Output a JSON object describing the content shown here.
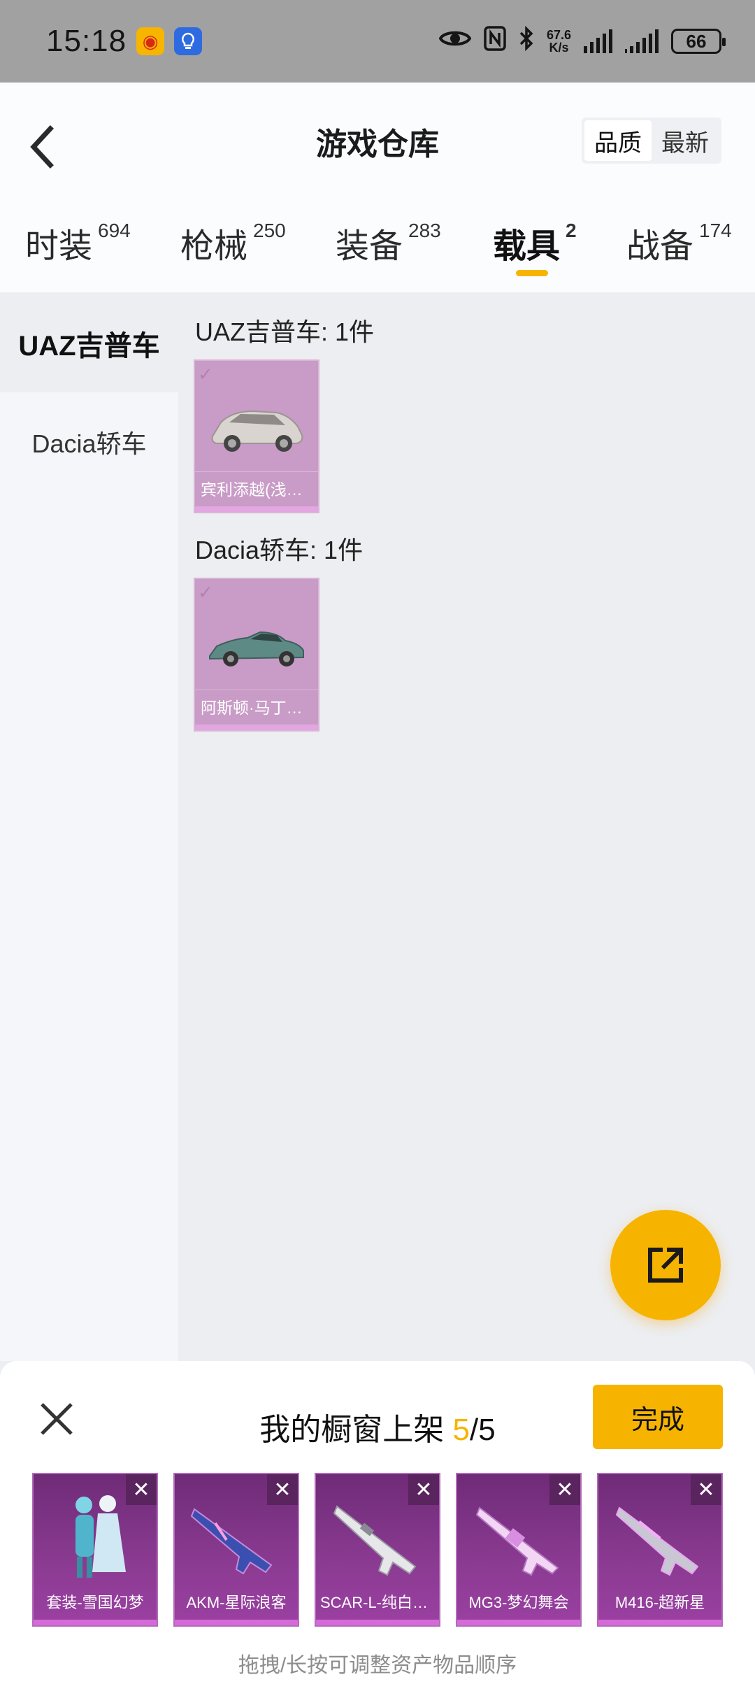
{
  "status_bar": {
    "time": "15:18",
    "net_speed_value": "67.6",
    "net_speed_unit": "K/s",
    "battery": "66",
    "icons": [
      "weibo-icon",
      "bulb-icon",
      "eye-icon",
      "nfc-icon",
      "bluetooth-icon",
      "signal-icon",
      "signal-icon",
      "battery-icon"
    ]
  },
  "header": {
    "title": "游戏仓库",
    "sort_options": [
      "品质",
      "最新"
    ]
  },
  "tabs": [
    {
      "label": "时装",
      "count": "694"
    },
    {
      "label": "枪械",
      "count": "250"
    },
    {
      "label": "装备",
      "count": "283"
    },
    {
      "label": "载具",
      "count": "2"
    },
    {
      "label": "战备",
      "count": "174"
    }
  ],
  "active_tab": "载具",
  "sidebar": {
    "items": [
      "UAZ吉普车",
      "Dacia轿车"
    ]
  },
  "groups": [
    {
      "title": "UAZ吉普车: 1件",
      "items": [
        {
          "label": "宾利添越(浅灰色)"
        }
      ]
    },
    {
      "title": "Dacia轿车: 1件",
      "items": [
        {
          "label": "阿斯顿·马丁DBS"
        }
      ]
    }
  ],
  "panel": {
    "title_prefix": "我的橱窗上架",
    "current": "5",
    "separator": "/",
    "total": "5",
    "done_label": "完成",
    "slots": [
      {
        "label": "套装-雪国幻梦"
      },
      {
        "label": "AKM-星际浪客"
      },
      {
        "label": "SCAR-L-纯白誓约"
      },
      {
        "label": "MG3-梦幻舞会"
      },
      {
        "label": "M416-超新星"
      }
    ],
    "hint": "拖拽/长按可调整资产物品顺序"
  },
  "colors": {
    "accent": "#f6b400",
    "card_purple": "#c99bc7",
    "slot_purple": "#8b3b92"
  }
}
